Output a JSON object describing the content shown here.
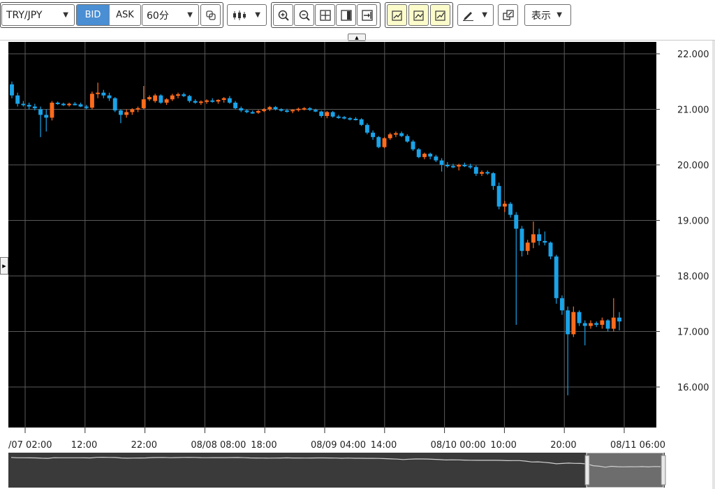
{
  "toolbar": {
    "symbol": "TRY/JPY",
    "bid_label": "BID",
    "ask_label": "ASK",
    "interval": "60分",
    "view_label": "表示"
  },
  "colors": {
    "background": "#000000",
    "up": "#ff6b1c",
    "down": "#1aa3e8",
    "grid": "#5a5a5a",
    "accent": "#4a8ed3"
  },
  "icons": [
    "copy-icon",
    "candlestick-icon",
    "zoom-in-icon",
    "zoom-out-icon",
    "fit-icon",
    "panel-icon",
    "scroll-end-icon",
    "indicator-add-icon",
    "indicator-edit-icon",
    "indicator-remove-icon",
    "draw-pen-icon",
    "popout-icon",
    "collapse-arrow-icon",
    "side-panel-arrow-icon"
  ],
  "chart_data": {
    "type": "candlestick",
    "y_ticks": [
      "22.000",
      "21.000",
      "20.000",
      "19.000",
      "18.000",
      "17.000",
      "16.000"
    ],
    "x_ticks": [
      "/07 02:00",
      "12:00",
      "22:00",
      "08/08 08:00",
      "18:00",
      "08/09 04:00",
      "14:00",
      "08/10 00:00",
      "10:00",
      "20:00",
      "08/11 06:00"
    ],
    "ylim": [
      15.0,
      22.1
    ],
    "grid": true,
    "candles": [
      {
        "o": 21.45,
        "h": 21.5,
        "l": 21.2,
        "c": 21.25
      },
      {
        "o": 21.25,
        "h": 21.3,
        "l": 21.05,
        "c": 21.1
      },
      {
        "o": 21.1,
        "h": 21.15,
        "l": 21.05,
        "c": 21.08
      },
      {
        "o": 21.08,
        "h": 21.12,
        "l": 21.0,
        "c": 21.05
      },
      {
        "o": 21.05,
        "h": 21.1,
        "l": 20.98,
        "c": 21.02
      },
      {
        "o": 21.0,
        "h": 21.05,
        "l": 20.5,
        "c": 20.9
      },
      {
        "o": 20.9,
        "h": 21.0,
        "l": 20.6,
        "c": 20.85
      },
      {
        "o": 20.85,
        "h": 21.15,
        "l": 20.8,
        "c": 21.12
      },
      {
        "o": 21.12,
        "h": 21.14,
        "l": 21.08,
        "c": 21.1
      },
      {
        "o": 21.1,
        "h": 21.12,
        "l": 21.06,
        "c": 21.08
      },
      {
        "o": 21.08,
        "h": 21.12,
        "l": 21.05,
        "c": 21.1
      },
      {
        "o": 21.1,
        "h": 21.13,
        "l": 21.07,
        "c": 21.09
      },
      {
        "o": 21.09,
        "h": 21.12,
        "l": 21.04,
        "c": 21.05
      },
      {
        "o": 21.05,
        "h": 21.08,
        "l": 21.0,
        "c": 21.03
      },
      {
        "o": 21.03,
        "h": 21.32,
        "l": 21.0,
        "c": 21.28
      },
      {
        "o": 21.28,
        "h": 21.48,
        "l": 21.2,
        "c": 21.3
      },
      {
        "o": 21.3,
        "h": 21.35,
        "l": 21.2,
        "c": 21.25
      },
      {
        "o": 21.25,
        "h": 21.3,
        "l": 21.15,
        "c": 21.2
      },
      {
        "o": 21.2,
        "h": 21.22,
        "l": 20.95,
        "c": 20.98
      },
      {
        "o": 20.98,
        "h": 21.0,
        "l": 20.75,
        "c": 20.9
      },
      {
        "o": 20.9,
        "h": 21.0,
        "l": 20.85,
        "c": 20.95
      },
      {
        "o": 20.95,
        "h": 21.02,
        "l": 20.9,
        "c": 21.0
      },
      {
        "o": 21.0,
        "h": 21.05,
        "l": 20.95,
        "c": 21.02
      },
      {
        "o": 21.02,
        "h": 21.42,
        "l": 21.0,
        "c": 21.18
      },
      {
        "o": 21.18,
        "h": 21.25,
        "l": 21.15,
        "c": 21.22
      },
      {
        "o": 21.15,
        "h": 21.28,
        "l": 21.12,
        "c": 21.25
      },
      {
        "o": 21.25,
        "h": 21.27,
        "l": 21.1,
        "c": 21.12
      },
      {
        "o": 21.12,
        "h": 21.2,
        "l": 21.08,
        "c": 21.18
      },
      {
        "o": 21.18,
        "h": 21.28,
        "l": 21.15,
        "c": 21.25
      },
      {
        "o": 21.25,
        "h": 21.3,
        "l": 21.2,
        "c": 21.27
      },
      {
        "o": 21.27,
        "h": 21.3,
        "l": 21.22,
        "c": 21.24
      },
      {
        "o": 21.24,
        "h": 21.26,
        "l": 21.12,
        "c": 21.15
      },
      {
        "o": 21.15,
        "h": 21.18,
        "l": 21.1,
        "c": 21.12
      },
      {
        "o": 21.12,
        "h": 21.16,
        "l": 21.08,
        "c": 21.14
      },
      {
        "o": 21.14,
        "h": 21.18,
        "l": 21.1,
        "c": 21.16
      },
      {
        "o": 21.16,
        "h": 21.2,
        "l": 21.12,
        "c": 21.14
      },
      {
        "o": 21.14,
        "h": 21.18,
        "l": 21.1,
        "c": 21.17
      },
      {
        "o": 21.17,
        "h": 21.22,
        "l": 21.12,
        "c": 21.2
      },
      {
        "o": 21.2,
        "h": 21.24,
        "l": 21.1,
        "c": 21.12
      },
      {
        "o": 21.12,
        "h": 21.15,
        "l": 21.0,
        "c": 21.02
      },
      {
        "o": 21.02,
        "h": 21.05,
        "l": 20.95,
        "c": 20.98
      },
      {
        "o": 20.98,
        "h": 21.0,
        "l": 20.93,
        "c": 20.95
      },
      {
        "o": 20.95,
        "h": 20.98,
        "l": 20.92,
        "c": 20.94
      },
      {
        "o": 20.94,
        "h": 20.99,
        "l": 20.92,
        "c": 20.97
      },
      {
        "o": 20.97,
        "h": 21.02,
        "l": 20.95,
        "c": 21.0
      },
      {
        "o": 21.0,
        "h": 21.06,
        "l": 20.97,
        "c": 21.04
      },
      {
        "o": 21.04,
        "h": 21.06,
        "l": 20.98,
        "c": 21.0
      },
      {
        "o": 21.0,
        "h": 21.02,
        "l": 20.96,
        "c": 20.98
      },
      {
        "o": 20.98,
        "h": 21.01,
        "l": 20.94,
        "c": 20.97
      },
      {
        "o": 20.97,
        "h": 21.0,
        "l": 20.93,
        "c": 20.99
      },
      {
        "o": 20.99,
        "h": 21.03,
        "l": 20.96,
        "c": 21.01
      },
      {
        "o": 21.01,
        "h": 21.04,
        "l": 20.98,
        "c": 21.02
      },
      {
        "o": 21.02,
        "h": 21.04,
        "l": 20.97,
        "c": 20.99
      },
      {
        "o": 20.99,
        "h": 21.01,
        "l": 20.95,
        "c": 20.96
      },
      {
        "o": 20.96,
        "h": 20.98,
        "l": 20.85,
        "c": 20.88
      },
      {
        "o": 20.88,
        "h": 20.97,
        "l": 20.84,
        "c": 20.95
      },
      {
        "o": 20.95,
        "h": 20.97,
        "l": 20.85,
        "c": 20.87
      },
      {
        "o": 20.87,
        "h": 20.9,
        "l": 20.83,
        "c": 20.86
      },
      {
        "o": 20.86,
        "h": 20.88,
        "l": 20.82,
        "c": 20.84
      },
      {
        "o": 20.84,
        "h": 20.86,
        "l": 20.8,
        "c": 20.83
      },
      {
        "o": 20.83,
        "h": 20.86,
        "l": 20.8,
        "c": 20.82
      },
      {
        "o": 20.82,
        "h": 20.84,
        "l": 20.7,
        "c": 20.72
      },
      {
        "o": 20.72,
        "h": 20.75,
        "l": 20.55,
        "c": 20.58
      },
      {
        "o": 20.58,
        "h": 20.62,
        "l": 20.45,
        "c": 20.5
      },
      {
        "o": 20.5,
        "h": 20.52,
        "l": 20.3,
        "c": 20.32
      },
      {
        "o": 20.32,
        "h": 20.5,
        "l": 20.3,
        "c": 20.48
      },
      {
        "o": 20.48,
        "h": 20.58,
        "l": 20.45,
        "c": 20.55
      },
      {
        "o": 20.55,
        "h": 20.6,
        "l": 20.5,
        "c": 20.57
      },
      {
        "o": 20.57,
        "h": 20.6,
        "l": 20.5,
        "c": 20.52
      },
      {
        "o": 20.52,
        "h": 20.55,
        "l": 20.4,
        "c": 20.42
      },
      {
        "o": 20.42,
        "h": 20.45,
        "l": 20.25,
        "c": 20.28
      },
      {
        "o": 20.28,
        "h": 20.3,
        "l": 20.12,
        "c": 20.14
      },
      {
        "o": 20.14,
        "h": 20.22,
        "l": 20.1,
        "c": 20.2
      },
      {
        "o": 20.2,
        "h": 20.22,
        "l": 20.1,
        "c": 20.15
      },
      {
        "o": 20.15,
        "h": 20.18,
        "l": 20.05,
        "c": 20.08
      },
      {
        "o": 20.08,
        "h": 20.12,
        "l": 19.88,
        "c": 20.0
      },
      {
        "o": 20.0,
        "h": 20.05,
        "l": 19.95,
        "c": 19.98
      },
      {
        "o": 19.98,
        "h": 20.02,
        "l": 19.94,
        "c": 19.97
      },
      {
        "o": 19.97,
        "h": 20.02,
        "l": 19.9,
        "c": 20.0
      },
      {
        "o": 20.0,
        "h": 20.04,
        "l": 19.96,
        "c": 19.98
      },
      {
        "o": 19.98,
        "h": 20.02,
        "l": 19.93,
        "c": 19.96
      },
      {
        "o": 19.96,
        "h": 19.99,
        "l": 19.8,
        "c": 19.84
      },
      {
        "o": 19.84,
        "h": 19.9,
        "l": 19.8,
        "c": 19.87
      },
      {
        "o": 19.87,
        "h": 19.9,
        "l": 19.82,
        "c": 19.85
      },
      {
        "o": 19.85,
        "h": 19.87,
        "l": 19.55,
        "c": 19.62
      },
      {
        "o": 19.62,
        "h": 19.68,
        "l": 19.2,
        "c": 19.25
      },
      {
        "o": 19.25,
        "h": 19.35,
        "l": 19.15,
        "c": 19.3
      },
      {
        "o": 19.3,
        "h": 19.33,
        "l": 19.05,
        "c": 19.1
      },
      {
        "o": 19.1,
        "h": 19.15,
        "l": 17.12,
        "c": 18.85
      },
      {
        "o": 18.85,
        "h": 18.9,
        "l": 18.35,
        "c": 18.45
      },
      {
        "o": 18.45,
        "h": 18.65,
        "l": 18.38,
        "c": 18.6
      },
      {
        "o": 18.6,
        "h": 18.98,
        "l": 18.5,
        "c": 18.75
      },
      {
        "o": 18.75,
        "h": 18.85,
        "l": 18.55,
        "c": 18.63
      },
      {
        "o": 18.63,
        "h": 18.8,
        "l": 18.55,
        "c": 18.6
      },
      {
        "o": 18.6,
        "h": 18.62,
        "l": 18.3,
        "c": 18.35
      },
      {
        "o": 18.35,
        "h": 18.38,
        "l": 17.5,
        "c": 17.6
      },
      {
        "o": 17.6,
        "h": 17.65,
        "l": 17.3,
        "c": 17.38
      },
      {
        "o": 17.38,
        "h": 17.45,
        "l": 15.85,
        "c": 16.95
      },
      {
        "o": 16.95,
        "h": 17.45,
        "l": 16.9,
        "c": 17.35
      },
      {
        "o": 17.35,
        "h": 17.38,
        "l": 17.1,
        "c": 17.15
      },
      {
        "o": 17.15,
        "h": 17.2,
        "l": 16.75,
        "c": 17.1
      },
      {
        "o": 17.1,
        "h": 17.2,
        "l": 17.05,
        "c": 17.15
      },
      {
        "o": 17.15,
        "h": 17.18,
        "l": 17.08,
        "c": 17.12
      },
      {
        "o": 17.12,
        "h": 17.25,
        "l": 17.05,
        "c": 17.2
      },
      {
        "o": 17.2,
        "h": 17.22,
        "l": 17.0,
        "c": 17.05
      },
      {
        "o": 17.05,
        "h": 17.6,
        "l": 17.0,
        "c": 17.25
      },
      {
        "o": 17.25,
        "h": 17.35,
        "l": 17.02,
        "c": 17.18
      }
    ]
  }
}
